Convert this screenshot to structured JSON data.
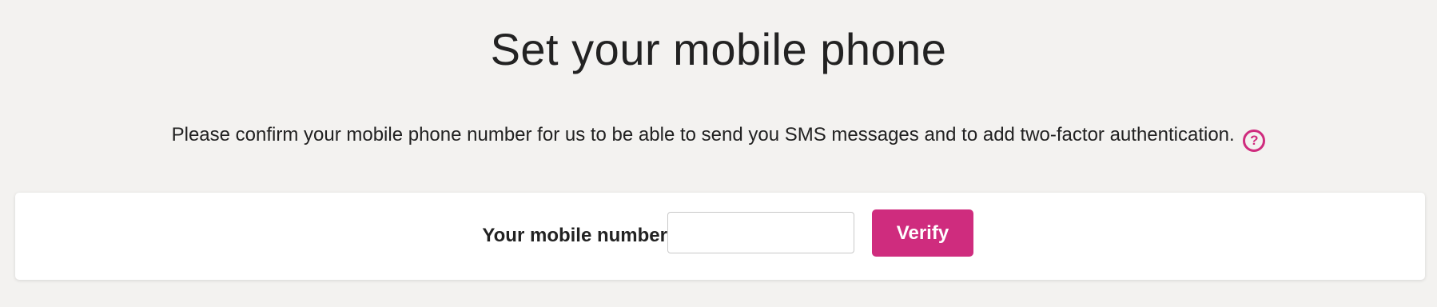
{
  "page": {
    "title": "Set your mobile phone",
    "intro_text": "Please confirm your mobile phone number for us to be able to send you SMS messages and to add two-factor authentication.",
    "help_icon_glyph": "?",
    "help_icon_name": "help-question-icon"
  },
  "form": {
    "mobile_label": "Your mobile number:",
    "mobile_value": "",
    "mobile_placeholder": "",
    "verify_label": "Verify"
  },
  "colors": {
    "accent": "#cf2c7e",
    "background": "#f3f2f0",
    "card": "#ffffff",
    "text": "#222222"
  }
}
